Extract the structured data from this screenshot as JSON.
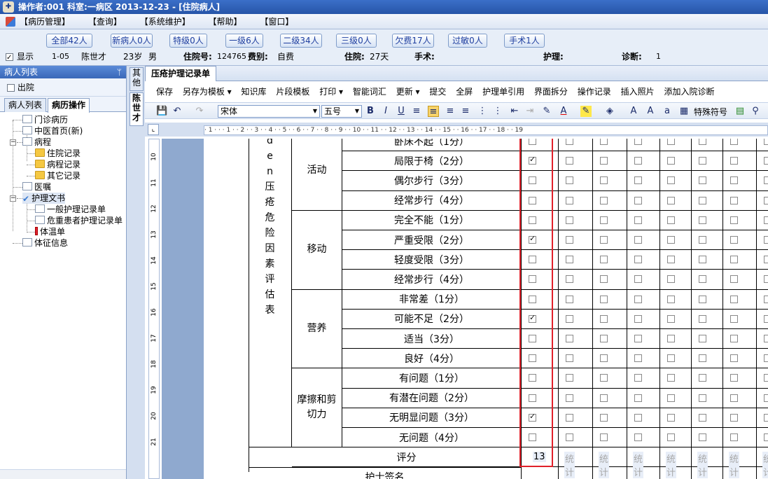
{
  "titlebar": {
    "text": "操作者:001  科室:一病区  2013-12-23 - [住院病人]"
  },
  "menu": [
    "【病历管理】",
    "【查询】",
    "【系统维护】",
    "【帮助】",
    "【窗口】"
  ],
  "filter_buttons": [
    "全部42人",
    "新病人0人",
    "特级0人",
    "一级6人",
    "二级34人",
    "三级0人",
    "欠费17人",
    "过敏0人",
    "手术1人"
  ],
  "patient": {
    "show_label": "显示",
    "bed": "1-05",
    "name": "陈世才",
    "age": "23岁",
    "sex": "男",
    "admission_no_label": "住院号:",
    "admission_no": "124765",
    "category_label": "费别:",
    "category": "自费",
    "stay_label": "住院:",
    "stay": "27天",
    "surgery_label": "手术:",
    "nursing_label": "护理:",
    "diagnosis_label": "诊断:",
    "diagnosis": "1"
  },
  "left_panel": {
    "header": "病人列表",
    "discharged_label": "出院",
    "tabs": [
      "病人列表",
      "病历操作"
    ],
    "tree": [
      {
        "label": "门诊病历",
        "icon": "doc-icon"
      },
      {
        "label": "中医首页(新)",
        "icon": "doc-icon"
      },
      {
        "label": "病程",
        "icon": "doc-icon"
      },
      {
        "label": "住院记录",
        "icon": "folder-icon"
      },
      {
        "label": "病程记录",
        "icon": "folder-icon"
      },
      {
        "label": "其它记录",
        "icon": "folder-icon"
      },
      {
        "label": "医嘱",
        "icon": "edit-icon"
      },
      {
        "label": "护理文书",
        "icon": "check-icon"
      },
      {
        "label": "一般护理记录单",
        "icon": "doc-icon"
      },
      {
        "label": "危重患者护理记录单",
        "icon": "doc-icon"
      },
      {
        "label": "体温单",
        "icon": "thermometer-icon"
      },
      {
        "label": "体征信息",
        "icon": "doc-icon"
      }
    ]
  },
  "side_tabs": [
    "其他",
    "陈世才"
  ],
  "document": {
    "tab_title": "压疮护理记录单",
    "toolbar1": [
      "保存",
      "另存为模板 ▾",
      "知识库",
      "片段模板",
      "打印 ▾",
      "智能词汇",
      "更新 ▾",
      "提交",
      "全屏",
      "护理单引用",
      "界面拆分",
      "操作记录",
      "插入照片",
      "添加入院诊断"
    ],
    "font_name": "宋体",
    "font_size": "五号",
    "special_symbol_label": "特殊符号",
    "ruler_text": "· 1 · · · 1 · · 2 · · 3 · · 4 · · 5 · · 6 · · 7 · · 8 · · 9 · · 10 · · 11 · · 12 · · 13 · · 14 · · 15 · · 16 · · 17 · · 18 · · 19",
    "vruler": [
      "10",
      "11",
      "12",
      "13",
      "14",
      "15",
      "16",
      "17",
      "18",
      "19",
      "20",
      "21"
    ]
  },
  "form": {
    "side_chars": [
      "d",
      "e",
      "n",
      "压",
      "疮",
      "危",
      "险",
      "因",
      "素",
      "评",
      "估",
      "表"
    ],
    "top_cut_item": "卧床不起（1分）",
    "groups": [
      {
        "name": "活动",
        "items": [
          "局限于椅（2分）",
          "偶尔步行（3分）",
          "经常步行（4分）"
        ]
      },
      {
        "name": "移动",
        "items": [
          "完全不能（1分）",
          "严重受限（2分）",
          "轻度受限（3分）",
          "经常步行（4分）"
        ]
      },
      {
        "name": "营养",
        "items": [
          "非常差（1分）",
          "可能不足（2分）",
          "适当（3分）",
          "良好（4分）"
        ]
      },
      {
        "name": "摩擦和剪切力",
        "items": [
          "有问题（1分）",
          "有潜在问题（2分）",
          "无明显问题（3分）",
          "无问题（4分）"
        ]
      }
    ],
    "checked_rows": [
      1,
      5,
      9,
      14
    ],
    "score_label": "评分",
    "score_value": "13",
    "stat_label": "统计",
    "nurse_sign_label": "护士签名"
  }
}
